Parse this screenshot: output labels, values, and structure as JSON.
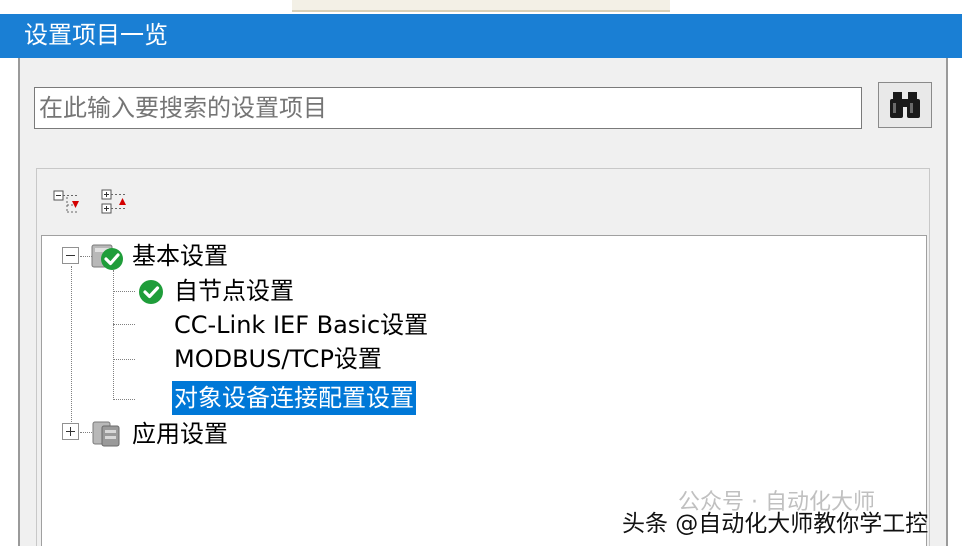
{
  "window": {
    "title": "设置项目一览"
  },
  "search": {
    "placeholder": "在此输入要搜索的设置项目",
    "button_icon": "binoculars-icon"
  },
  "toolbar": {
    "expand_all_icon": "expand-all-icon",
    "collapse_all_icon": "collapse-all-icon"
  },
  "tree": {
    "basic": {
      "label": "基本设置",
      "expanded": true,
      "children": [
        {
          "label": "自节点设置",
          "icon": "check-icon"
        },
        {
          "label": "CC-Link IEF Basic设置"
        },
        {
          "label": "MODBUS/TCP设置"
        },
        {
          "label": "对象设备连接配置设置",
          "selected": true
        }
      ]
    },
    "app": {
      "label": "应用设置",
      "expanded": false
    }
  },
  "watermark": {
    "text": "公众号 · 自动化大师"
  },
  "caption": {
    "text": "头条 @自动化大师教你学工控"
  },
  "colors": {
    "titlebar": "#1a7fd4",
    "selection": "#0078d7",
    "check": "#1f9d3a"
  }
}
